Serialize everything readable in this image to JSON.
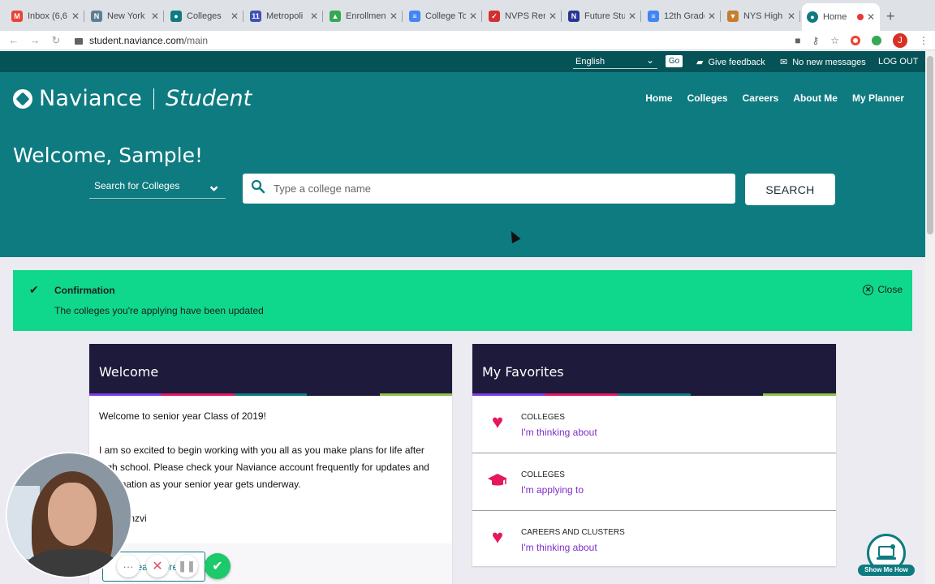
{
  "browser": {
    "tabs": [
      {
        "title": "Inbox (6,6",
        "fav_color": "#ea4335",
        "fav_glyph": "M"
      },
      {
        "title": "New York",
        "fav_color": "#5f7d95",
        "fav_glyph": "N"
      },
      {
        "title": "Colleges",
        "fav_color": "#0e7b80",
        "fav_glyph": "●"
      },
      {
        "title": "Metropoli",
        "fav_color": "#3f51b5",
        "fav_glyph": "11"
      },
      {
        "title": "Enrollmen",
        "fav_color": "#34a853",
        "fav_glyph": "▲"
      },
      {
        "title": "College To",
        "fav_color": "#4285f4",
        "fav_glyph": "≡"
      },
      {
        "title": "NVPS Ren",
        "fav_color": "#d32f2f",
        "fav_glyph": "✓"
      },
      {
        "title": "Future Stu",
        "fav_color": "#283593",
        "fav_glyph": "N"
      },
      {
        "title": "12th Grade",
        "fav_color": "#4285f4",
        "fav_glyph": "≡"
      },
      {
        "title": "NYS High",
        "fav_color": "#c77d2e",
        "fav_glyph": "▼"
      }
    ],
    "active_tab": {
      "title": "Home",
      "fav_color": "#0e7b80",
      "fav_glyph": "●"
    },
    "url_host": "student.naviance.com",
    "url_path": "/main",
    "profile_initial": "J"
  },
  "topstrip": {
    "language": "English",
    "go_label": "Go",
    "feedback_label": "Give feedback",
    "messages_label": "No new messages",
    "logout_label": "LOG OUT"
  },
  "header": {
    "brand": "Naviance",
    "product": "Student",
    "nav": [
      "Home",
      "Colleges",
      "Careers",
      "About Me",
      "My Planner"
    ]
  },
  "hero": {
    "welcome": "Welcome, Sample!",
    "search_type": "Search for Colleges",
    "search_placeholder": "Type a college name",
    "search_button": "SEARCH"
  },
  "confirmation": {
    "title": "Confirmation",
    "message": "The colleges you're applying have been updated",
    "close_label": "Close"
  },
  "welcome_card": {
    "title": "Welcome",
    "paragraphs": [
      "Welcome to senior year Class of 2019!",
      "I am so excited to begin working with you all as you make plans for life after high school. Please check your Naviance account frequently for updates and information as your senior year gets underway.",
      "Ms. Kanzvi"
    ],
    "read_more": "Read More"
  },
  "favorites_card": {
    "title": "My Favorites",
    "items": [
      {
        "category": "COLLEGES",
        "link": "I'm thinking about",
        "icon": "heart-icon"
      },
      {
        "category": "COLLEGES",
        "link": "I'm applying to",
        "icon": "graduation-cap-icon"
      },
      {
        "category": "CAREERS AND CLUSTERS",
        "link": "I'm thinking about",
        "icon": "heart-icon"
      }
    ]
  },
  "show_me_how": {
    "label": "Show Me How"
  },
  "colors": {
    "hero_teal": "#0e7b80",
    "strip_dark": "#055257",
    "confirm_green": "#0fd88c",
    "card_header": "#1e1a3b",
    "link_purple": "#7e2fc9",
    "heart_pink": "#e5185f",
    "rainbow": [
      "#7b3fe4",
      "#e5185f",
      "#0e7b80",
      "#1e1a3b",
      "#8bc34a"
    ]
  }
}
